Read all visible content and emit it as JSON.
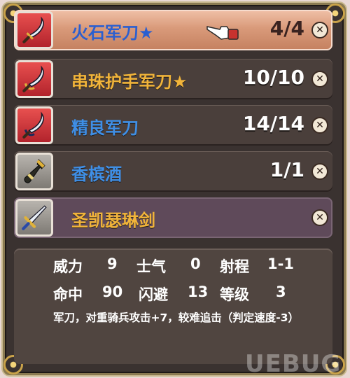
{
  "items": [
    {
      "name": "火石军刀★",
      "count": "4/4",
      "icon": "sabre-icon",
      "state": "selected",
      "name_color": "blue"
    },
    {
      "name": "串珠护手军刀★",
      "count": "10/10",
      "icon": "sabre-icon",
      "state": "normal",
      "name_color": "gold"
    },
    {
      "name": "精良军刀",
      "count": "14/14",
      "icon": "sabre-icon",
      "state": "normal",
      "name_color": "blue"
    },
    {
      "name": "香槟酒",
      "count": "1/1",
      "icon": "champagne-bottle-icon",
      "state": "normal",
      "name_color": "blue"
    },
    {
      "name": "圣凯瑟琳剑",
      "count": "",
      "icon": "sword-icon",
      "state": "dimmed",
      "name_color": "gold"
    }
  ],
  "close_glyph": "✕",
  "stats": {
    "power_label": "威力",
    "power_value": "9",
    "morale_label": "士气",
    "morale_value": "0",
    "range_label": "射程",
    "range_value": "1-1",
    "accuracy_label": "命中",
    "accuracy_value": "90",
    "evasion_label": "闪避",
    "evasion_value": "13",
    "level_label": "等级",
    "level_value": "3"
  },
  "description": "军刀，对重骑兵攻击+7，较难追击（判定速度-3）",
  "watermark": "UEBUG"
}
